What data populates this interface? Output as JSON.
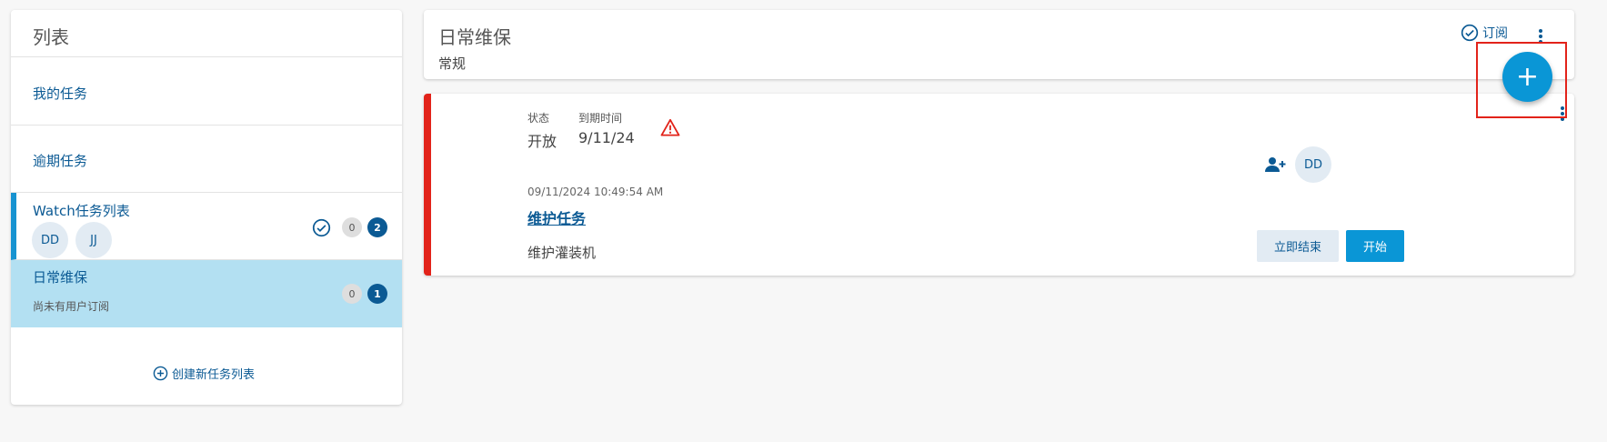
{
  "sidebar": {
    "title": "列表",
    "my_tasks": "我的任务",
    "overdue": "逾期任务",
    "watch": {
      "label": "Watch任务列表",
      "avatars": [
        "DD",
        "JJ"
      ],
      "count_gray": "0",
      "count_blue": "2"
    },
    "daily": {
      "label": "日常维保",
      "sub": "尚未有用户订阅",
      "count_gray": "0",
      "count_blue": "1"
    },
    "create": "创建新任务列表"
  },
  "header": {
    "title": "日常维保",
    "subtitle": "常规",
    "subscribe": "订阅"
  },
  "task": {
    "status_label": "状态",
    "status_value": "开放",
    "due_label": "到期时间",
    "due_value": "9/11/24",
    "timestamp": "09/11/2024 10:49:54 AM",
    "title": "维护任务",
    "description": "维护灌装机",
    "assignee": "DD",
    "end_button": "立即结束",
    "start_button": "开始"
  },
  "fab": {
    "label": "+"
  },
  "colors": {
    "accent": "#0a96d6",
    "brand": "#0b5a94",
    "warning": "#e2231a",
    "selected": "#b3e0f2"
  }
}
